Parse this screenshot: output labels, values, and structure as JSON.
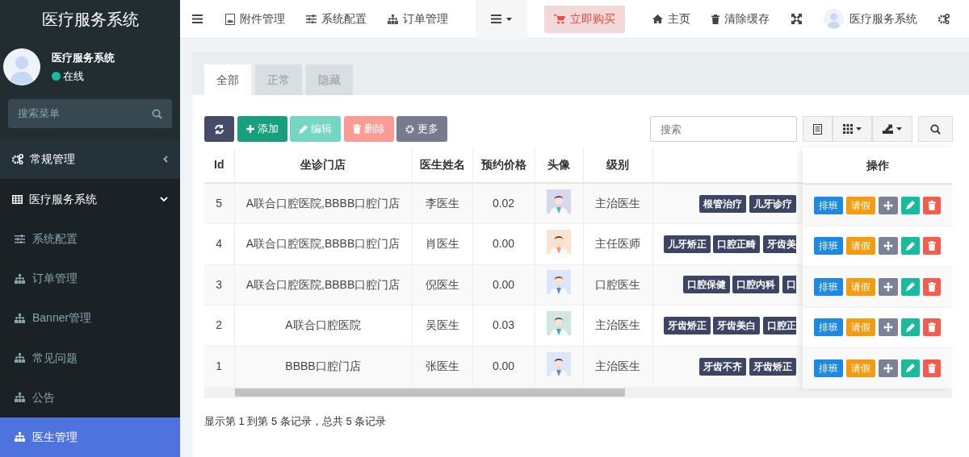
{
  "header": {
    "brand": "医疗服务系统",
    "nav": [
      {
        "label": "附件管理"
      },
      {
        "label": "系统配置"
      },
      {
        "label": "订单管理"
      }
    ],
    "buy_button": "立即购买",
    "links": [
      {
        "label": "主页"
      },
      {
        "label": "清除缓存"
      }
    ],
    "user": "医疗服务系统"
  },
  "sidebar": {
    "user": {
      "name": "医疗服务系统",
      "status": "在线"
    },
    "search": {
      "placeholder": "搜索菜单"
    },
    "items": [
      {
        "label": "常规管理",
        "expanded": false
      },
      {
        "label": "医疗服务系统",
        "expanded": true,
        "children": [
          {
            "label": "系统配置",
            "selected": false
          },
          {
            "label": "订单管理",
            "selected": false
          },
          {
            "label": "Banner管理",
            "selected": false
          },
          {
            "label": "常见问题",
            "selected": false
          },
          {
            "label": "公告",
            "selected": false
          },
          {
            "label": "医生管理",
            "selected": true
          }
        ]
      }
    ]
  },
  "tabs": [
    {
      "label": "全部",
      "selected": true
    },
    {
      "label": "正常",
      "selected": false
    },
    {
      "label": "隐藏",
      "selected": false
    }
  ],
  "toolbar": {
    "buttons": [
      {
        "kind": "refresh",
        "disabled": false
      },
      {
        "kind": "add",
        "label": "添加",
        "disabled": false
      },
      {
        "kind": "edit",
        "label": "编辑",
        "disabled": true
      },
      {
        "kind": "delete",
        "label": "删除",
        "disabled": true
      },
      {
        "kind": "more",
        "label": "更多",
        "disabled": false
      }
    ],
    "search": {
      "placeholder": "搜索"
    }
  },
  "table": {
    "columns": [
      "Id",
      "坐诊门店",
      "医生姓名",
      "预约价格",
      "头像",
      "级别",
      "操作"
    ],
    "rows": [
      {
        "id": "5",
        "store": "A联合口腔医院,BBBB口腔门店",
        "name": "李医生",
        "price": "0.02",
        "level": "主治医生",
        "tags": [
          "根管治疗",
          "儿牙诊疗"
        ],
        "cut_tag": "",
        "actions": [
          "排班",
          "请假"
        ]
      },
      {
        "id": "4",
        "store": "A联合口腔医院,BBBB口腔门店",
        "name": "肖医生",
        "price": "0.00",
        "level": "主任医师",
        "tags": [
          "儿牙矫正",
          "口腔正畸"
        ],
        "cut_tag": "牙齿美",
        "actions": [
          "排班",
          "请假"
        ]
      },
      {
        "id": "3",
        "store": "A联合口腔医院,BBBB口腔门店",
        "name": "倪医生",
        "price": "0.00",
        "level": "口腔医生",
        "tags": [
          "口腔保健",
          "口腔内科"
        ],
        "cut_tag": "口",
        "actions": [
          "排班",
          "请假"
        ]
      },
      {
        "id": "2",
        "store": "A联合口腔医院",
        "name": "吴医生",
        "price": "0.03",
        "level": "主治医生",
        "tags": [
          "牙齿矫正",
          "牙齿美白"
        ],
        "cut_tag": "口腔正",
        "actions": [
          "排班",
          "请假"
        ]
      },
      {
        "id": "1",
        "store": "BBBB口腔门店",
        "name": "张医生",
        "price": "0.00",
        "level": "主治医生",
        "tags": [
          "牙齿不齐",
          "牙齿矫正"
        ],
        "cut_tag": "",
        "actions": [
          "排班",
          "请假"
        ]
      }
    ]
  },
  "footer": "显示第 1 到第 5 条记录，总共 5 条记录"
}
